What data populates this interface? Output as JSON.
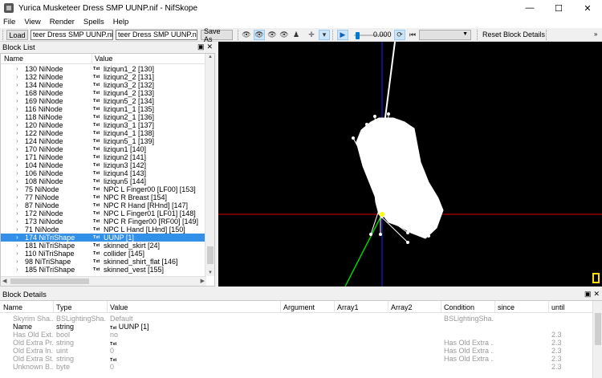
{
  "window": {
    "title": "Yurica Musketeer Dress SMP UUNP.nif - NifSkope",
    "buttons": {
      "minimize": "—",
      "maximize": "☐",
      "close": "✕"
    }
  },
  "menu": [
    "File",
    "View",
    "Render",
    "Spells",
    "Help"
  ],
  "toolbar": {
    "load_label": "Load",
    "load_path": "teer Dress SMP UUNP.nif",
    "save_path": "teer Dress SMP UUNP.nif",
    "save_as_label": "Save As",
    "time_value": "0.000",
    "time_position": 0.0,
    "reset_label": "Reset Block Details",
    "icons": [
      "eye-icon",
      "eye-icon",
      "eye-icon",
      "eye-icon",
      "figure-icon",
      "axes-icon",
      "view-icon",
      "play-icon",
      "loop-icon",
      "switch-icon"
    ]
  },
  "block_list": {
    "title": "Block List",
    "columns": {
      "name": "Name",
      "value": "Value"
    },
    "txt_tag": "Txt",
    "rows": [
      {
        "name": "130 NiNode",
        "value": "liziqun1_2 [130]"
      },
      {
        "name": "132 NiNode",
        "value": "liziqun2_2 [131]"
      },
      {
        "name": "134 NiNode",
        "value": "liziqun3_2 [132]"
      },
      {
        "name": "168 NiNode",
        "value": "liziqun4_2 [133]"
      },
      {
        "name": "169 NiNode",
        "value": "liziqun5_2 [134]"
      },
      {
        "name": "116 NiNode",
        "value": "liziqun1_1 [135]"
      },
      {
        "name": "118 NiNode",
        "value": "liziqun2_1 [136]"
      },
      {
        "name": "120 NiNode",
        "value": "liziqun3_1 [137]"
      },
      {
        "name": "122 NiNode",
        "value": "liziqun4_1 [138]"
      },
      {
        "name": "124 NiNode",
        "value": "liziqun5_1 [139]"
      },
      {
        "name": "170 NiNode",
        "value": "liziqun1 [140]"
      },
      {
        "name": "171 NiNode",
        "value": "liziqun2 [141]"
      },
      {
        "name": "104 NiNode",
        "value": "liziqun3 [142]"
      },
      {
        "name": "106 NiNode",
        "value": "liziqun4 [143]"
      },
      {
        "name": "108 NiNode",
        "value": "liziqun5 [144]"
      },
      {
        "name": "75 NiNode",
        "value": "NPC L Finger00 [LF00] [153]"
      },
      {
        "name": "77 NiNode",
        "value": "NPC R Breast [154]"
      },
      {
        "name": "87 NiNode",
        "value": "NPC R Hand [RHnd] [147]"
      },
      {
        "name": "172 NiNode",
        "value": "NPC L Finger01 [LF01] [148]"
      },
      {
        "name": "173 NiNode",
        "value": "NPC R Finger00 [RF00] [149]"
      },
      {
        "name": "71 NiNode",
        "value": "NPC L Hand [LHnd] [150]"
      },
      {
        "name": "174 NiTriShape",
        "value": "UUNP [1]",
        "selected": true
      },
      {
        "name": "181 NiTriShape",
        "value": "skinned_skirt [24]"
      },
      {
        "name": "110 NiTriShape",
        "value": "collider [145]"
      },
      {
        "name": "98 NiTriShape",
        "value": "skinned_shirt_flat [146]"
      },
      {
        "name": "185 NiTriShape",
        "value": "skinned_vest [155]"
      }
    ]
  },
  "block_details": {
    "title": "Block Details",
    "columns": [
      "Name",
      "Type",
      "Value",
      "Argument",
      "Array1",
      "Array2",
      "Condition",
      "since",
      "until"
    ],
    "txt_tag": "Txt",
    "rows": [
      {
        "name": "Skyrim Sha...",
        "type": "BSLightingSha...",
        "value": "Default",
        "condition": "BSLightingSha...",
        "until": "",
        "strong": false
      },
      {
        "name": "Name",
        "type": "string",
        "value": "UUNP [1]",
        "txt": true,
        "condition": "",
        "until": "",
        "strong": true
      },
      {
        "name": "Has Old Ext...",
        "type": "bool",
        "value": "no",
        "condition": "",
        "until": "2.3",
        "strong": false
      },
      {
        "name": "Old Extra Pr...",
        "type": "string",
        "value": "",
        "txt": true,
        "condition": "Has Old Extra ...",
        "until": "2.3",
        "strong": false
      },
      {
        "name": "Old Extra In...",
        "type": "uint",
        "value": "0",
        "condition": "Has Old Extra ...",
        "until": "2.3",
        "strong": false
      },
      {
        "name": "Old Extra St...",
        "type": "string",
        "value": "",
        "txt": true,
        "condition": "Has Old Extra ...",
        "until": "2.3",
        "strong": false
      },
      {
        "name": "Unknown B...",
        "type": "byte",
        "value": "0",
        "condition": "",
        "until": "2.3",
        "strong": false
      }
    ]
  },
  "colors": {
    "selection": "#3390e8",
    "viewport_bg": "#000000",
    "axis_x": "#e00000",
    "axis_y": "#00d000",
    "axis_z": "#2020ff",
    "mesh": "#ffffff",
    "marker": "#ffdd00"
  }
}
